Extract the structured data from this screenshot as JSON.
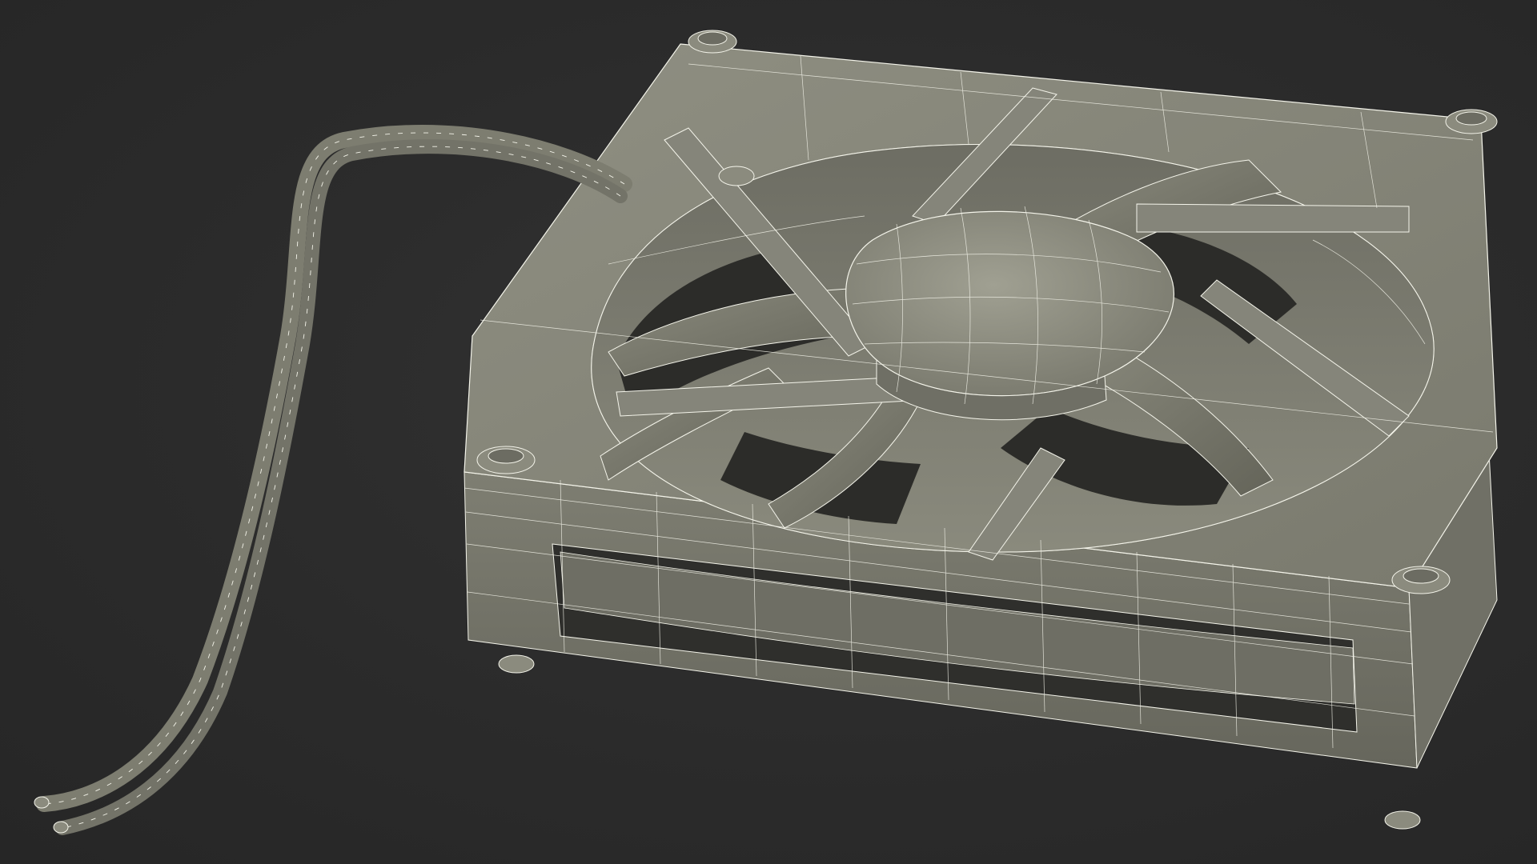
{
  "scene": {
    "subject": "fan-wireframe-render",
    "background_color": "#2b2b2b",
    "surface_color": "#7d7d70",
    "surface_light_color": "#8e8e80",
    "surface_dark_color": "#5e5e54",
    "wire_color": "#f4f4ea"
  }
}
